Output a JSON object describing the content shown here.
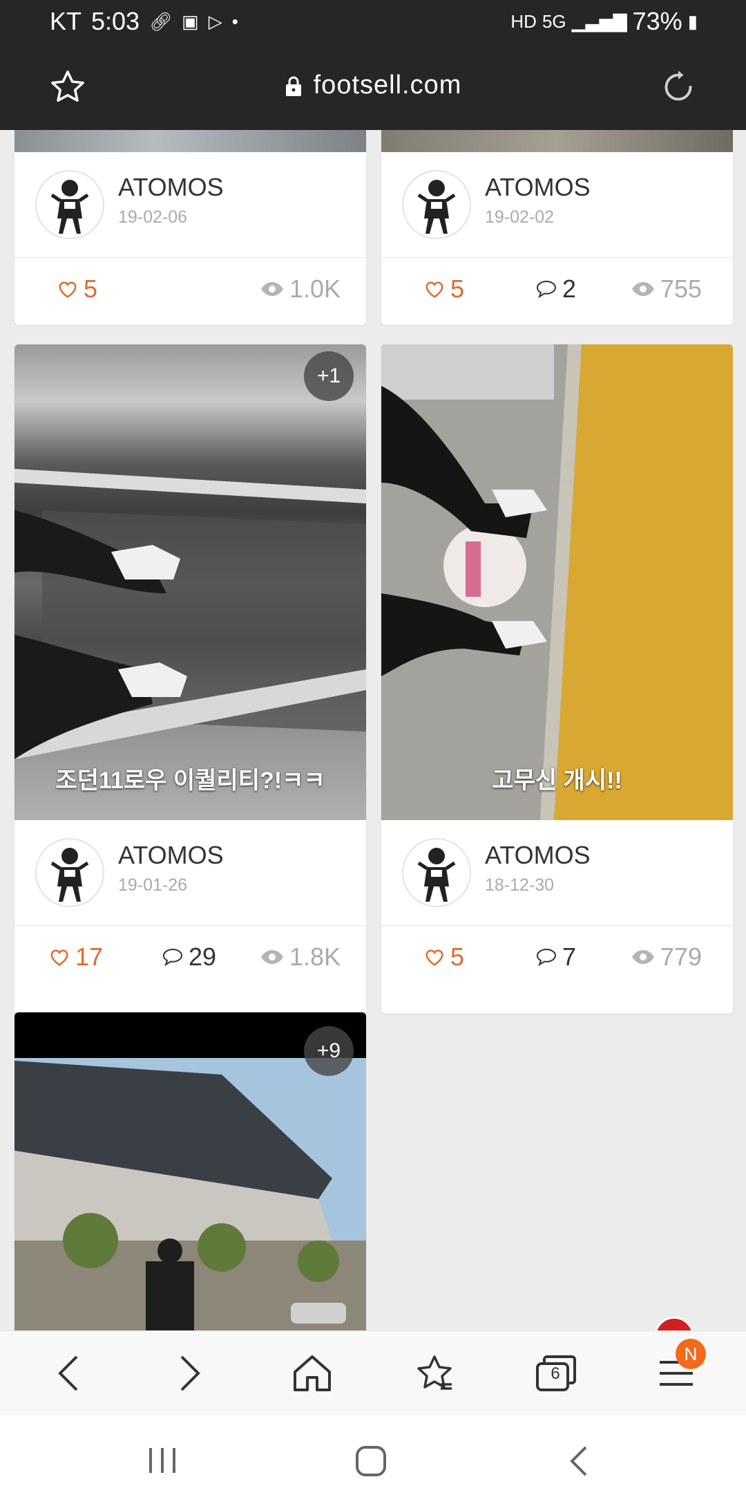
{
  "status_bar": {
    "carrier": "KT",
    "time": "5:03",
    "battery": "73%"
  },
  "url_bar": {
    "url": "footsell.com"
  },
  "posts": [
    {
      "author": "ATOMOS",
      "date": "19-02-06",
      "likes": "5",
      "comments": "",
      "views": "1.0K"
    },
    {
      "author": "ATOMOS",
      "date": "19-02-02",
      "likes": "5",
      "comments": "2",
      "views": "755"
    },
    {
      "author": "ATOMOS",
      "date": "19-01-26",
      "likes": "17",
      "comments": "29",
      "views": "1.8K",
      "caption": "조던11로우 이퀄리티?!ㅋㅋ",
      "extra_images": "+1"
    },
    {
      "author": "ATOMOS",
      "date": "18-12-30",
      "likes": "5",
      "comments": "7",
      "views": "779",
      "caption": "고무신 개시!!"
    },
    {
      "extra_images": "+9"
    }
  ],
  "bottom_nav": {
    "tabs_count": "6",
    "menu_badge": "N"
  },
  "colors": {
    "accent": "#e06a2c",
    "badge": "#f26a1b",
    "chrome": "#262626"
  }
}
